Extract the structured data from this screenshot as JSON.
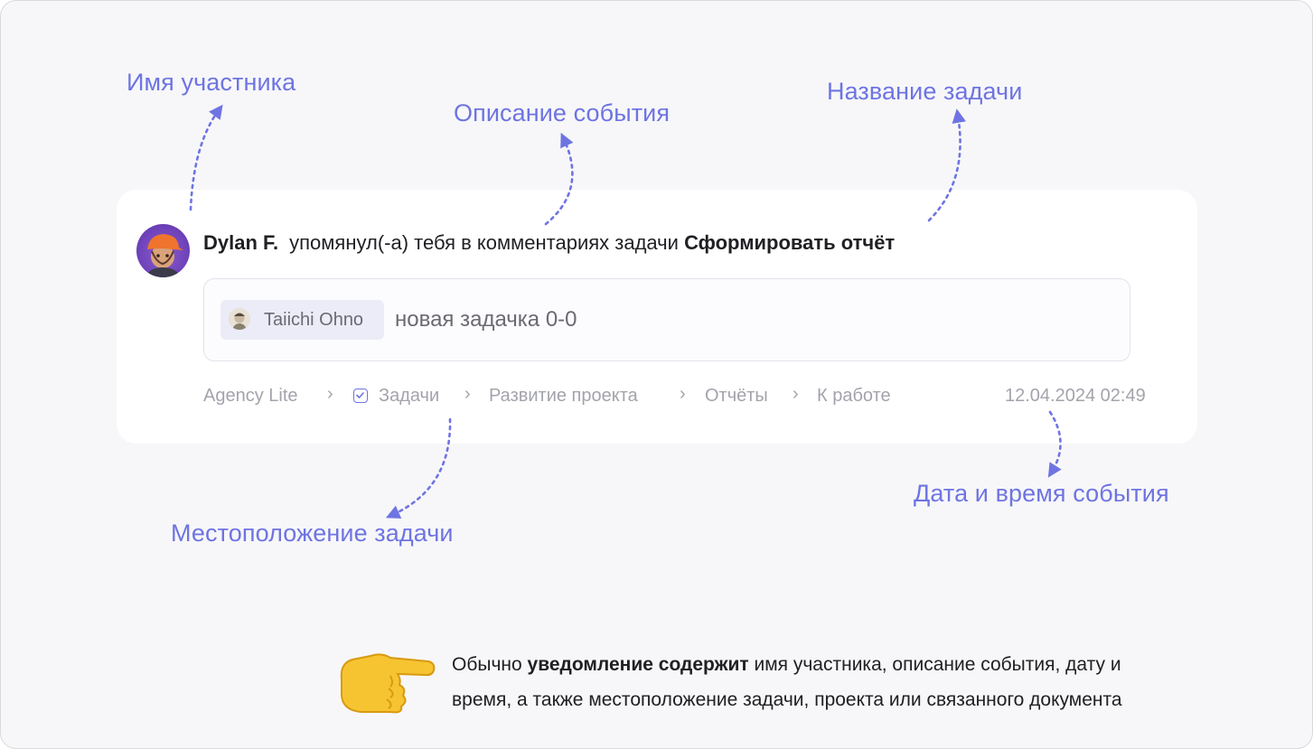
{
  "annotations": {
    "participant_name": "Имя участника",
    "event_description": "Описание события",
    "task_name": "Название задачи",
    "task_location": "Местоположение задачи",
    "event_datetime": "Дата и время события"
  },
  "notification": {
    "actor": "Dylan F.",
    "action": "упомянул(-а) тебя в комментариях задачи",
    "task": "Сформировать отчёт",
    "comment": {
      "mention": "Taiichi Ohno",
      "text": "новая задачка 0-0"
    },
    "breadcrumb": [
      "Agency Lite",
      "Задачи",
      "Развитие проекта",
      "Отчёты",
      "К работе"
    ],
    "datetime": "12.04.2024 02:49"
  },
  "note": {
    "prefix": "Обычно ",
    "bold": "уведомление содержит",
    "rest_line1": " имя участника, описание события, дату и",
    "line2": "время, а также местоположение задачи, проекта или связанного документа"
  },
  "colors": {
    "accent": "#6e74e2",
    "muted_text": "#a3a3ac",
    "background": "#f7f7f9",
    "card": "#ffffff"
  },
  "icons": {
    "pointer": "backhand-index-pointing-right-icon",
    "task": "task-checkbox-icon",
    "separator": "chevron-right-icon"
  }
}
